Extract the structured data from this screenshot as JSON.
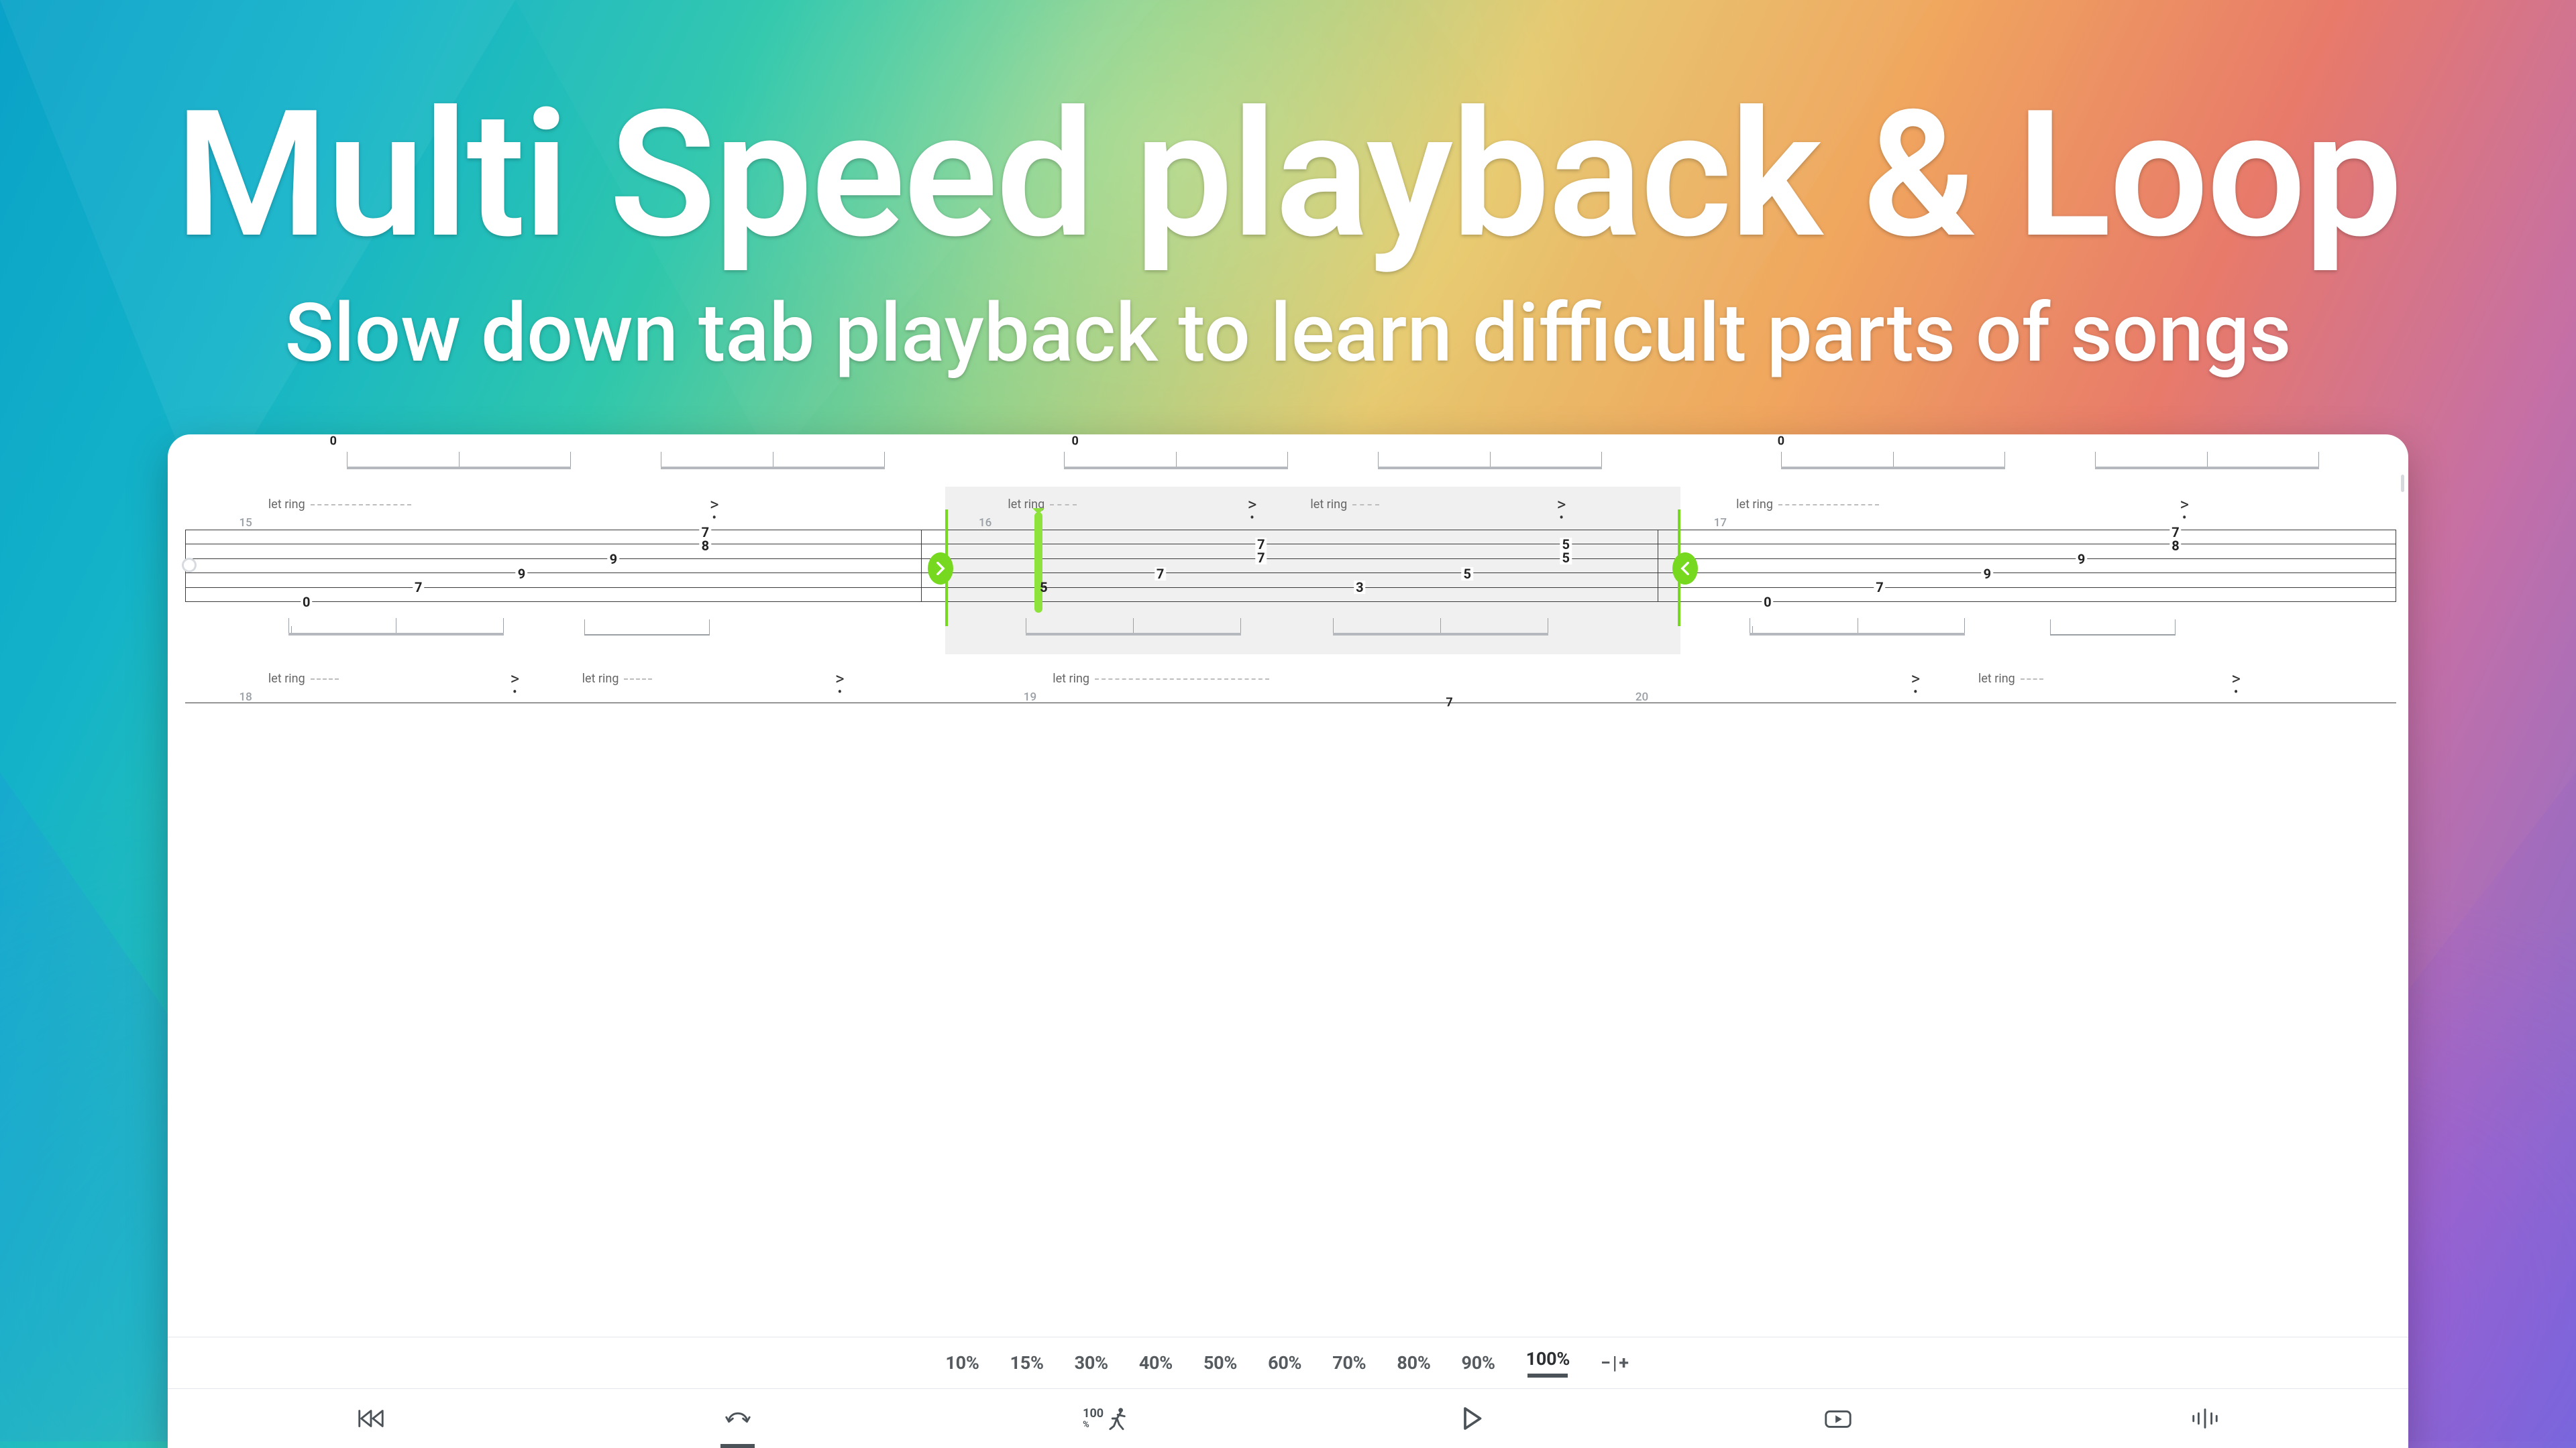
{
  "hero": {
    "title": "Multi Speed playback & Loop",
    "subtitle": "Slow down tab playback to learn difficult parts of songs"
  },
  "annotations": {
    "let_ring": "let ring",
    "accent": ">"
  },
  "top_zeros": [
    "0",
    "0",
    "0"
  ],
  "measures": {
    "m15": {
      "number": "15",
      "frets": [
        {
          "x": 8,
          "string": 6,
          "v": "0"
        },
        {
          "x": 22,
          "string": 5,
          "v": "7"
        },
        {
          "x": 36,
          "string": 4,
          "v": "9"
        },
        {
          "x": 50,
          "string": 3,
          "v": "9"
        },
        {
          "x": 64,
          "string": 1,
          "v": "7"
        },
        {
          "x": 64,
          "string": 2,
          "v": "8"
        }
      ]
    },
    "m16": {
      "number": "16",
      "playhead_fret": "5",
      "frets": [
        {
          "x": 25,
          "string": 4,
          "v": "7"
        },
        {
          "x": 38,
          "string": 2,
          "v": "7"
        },
        {
          "x": 38,
          "string": 3,
          "v": "7"
        },
        {
          "x": 55,
          "string": 5,
          "v": "3"
        },
        {
          "x": 70,
          "string": 4,
          "v": "5"
        },
        {
          "x": 83,
          "string": 2,
          "v": "5"
        },
        {
          "x": 83,
          "string": 3,
          "v": "5"
        }
      ]
    },
    "m17": {
      "number": "17",
      "frets": [
        {
          "x": 8,
          "string": 6,
          "v": "0"
        },
        {
          "x": 22,
          "string": 5,
          "v": "7"
        },
        {
          "x": 36,
          "string": 4,
          "v": "9"
        },
        {
          "x": 50,
          "string": 3,
          "v": "9"
        },
        {
          "x": 64,
          "string": 1,
          "v": "7"
        },
        {
          "x": 64,
          "string": 2,
          "v": "8"
        }
      ]
    },
    "m18": {
      "number": "18"
    },
    "m19": {
      "number": "19",
      "peek_fret": "7"
    },
    "m20": {
      "number": "20"
    }
  },
  "speed_bar": {
    "options": [
      "10%",
      "15%",
      "30%",
      "40%",
      "50%",
      "60%",
      "70%",
      "80%",
      "90%",
      "100%"
    ],
    "active_index": 9,
    "fine_label": "−|+"
  },
  "toolbar": {
    "speed_value": "100",
    "speed_unit": "%"
  }
}
